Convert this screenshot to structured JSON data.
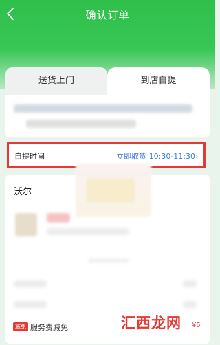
{
  "header": {
    "title": "确认订单",
    "back_icon": "back-arrow-icon"
  },
  "tabs": [
    {
      "label": "送货上门",
      "active": false
    },
    {
      "label": "到店自提",
      "active": true
    }
  ],
  "pickup": {
    "label": "自提时间",
    "value": "立即取货 10:30-11:30",
    "chevron_icon": "chevron-right-icon"
  },
  "store": {
    "name": "沃尔"
  },
  "promo": {
    "tag": "减免",
    "text": "服务费减免",
    "amount": "¥5"
  },
  "watermark": "汇西龙网",
  "colors": {
    "header_green": "#2fbf4a",
    "highlight_red": "#e53935",
    "link_blue": "#3f7be0"
  }
}
